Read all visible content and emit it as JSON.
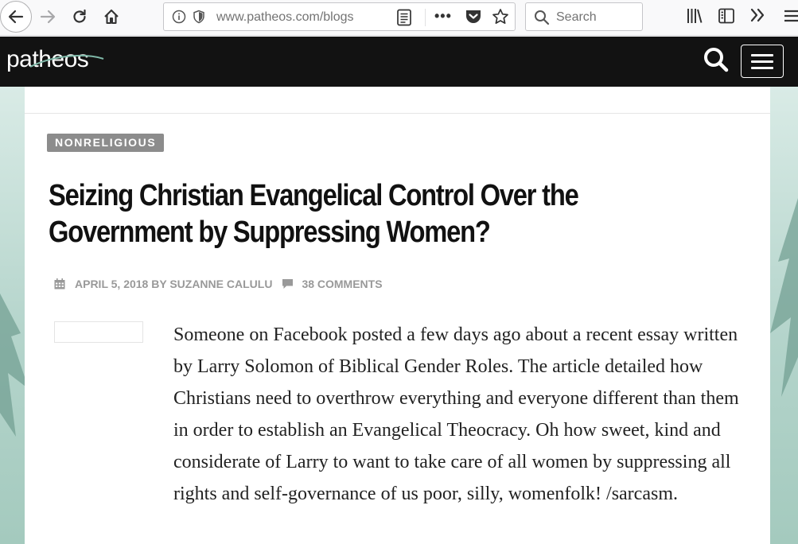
{
  "browser": {
    "url": "www.patheos.com/blogs",
    "search_placeholder": "Search"
  },
  "site": {
    "logo_text": "patheos"
  },
  "article": {
    "category": "NONRELIGIOUS",
    "title": "Seizing Christian Evangelical Control Over the Government by Suppressing Women?",
    "byline": "APRIL 5, 2018 BY SUZANNE CALULU",
    "comments": "38 COMMENTS",
    "body": "Someone on Facebook posted a few days ago about a recent essay written by Larry Solomon of Biblical Gender Roles. The article detailed how Christians need to overthrow everything and everyone different than them in order to establish an Evangelical Theocracy. Oh how sweet, kind and considerate of Larry to want to take care of all women by suppressing all rights and self-governance of us poor, silly, womenfolk! /sarcasm."
  },
  "icons": {
    "back": "back-arrow-icon",
    "forward": "forward-arrow-icon",
    "reload": "reload-icon",
    "home": "home-icon",
    "info": "info-icon",
    "shield": "tracking-shield-icon",
    "reader": "reader-view-icon",
    "pocket": "pocket-icon",
    "star": "bookmark-star-icon",
    "library": "library-icon",
    "sidebar": "sidebar-icon",
    "overflow": "overflow-chevron-icon",
    "menu": "hamburger-menu-icon",
    "site_search": "search-icon",
    "calendar": "calendar-icon",
    "comment": "comment-icon"
  },
  "colors": {
    "header_bg": "#121212",
    "tag_bg": "#8c8c8c",
    "meta_text": "#999999",
    "page_bg": "#b4d4cb"
  }
}
